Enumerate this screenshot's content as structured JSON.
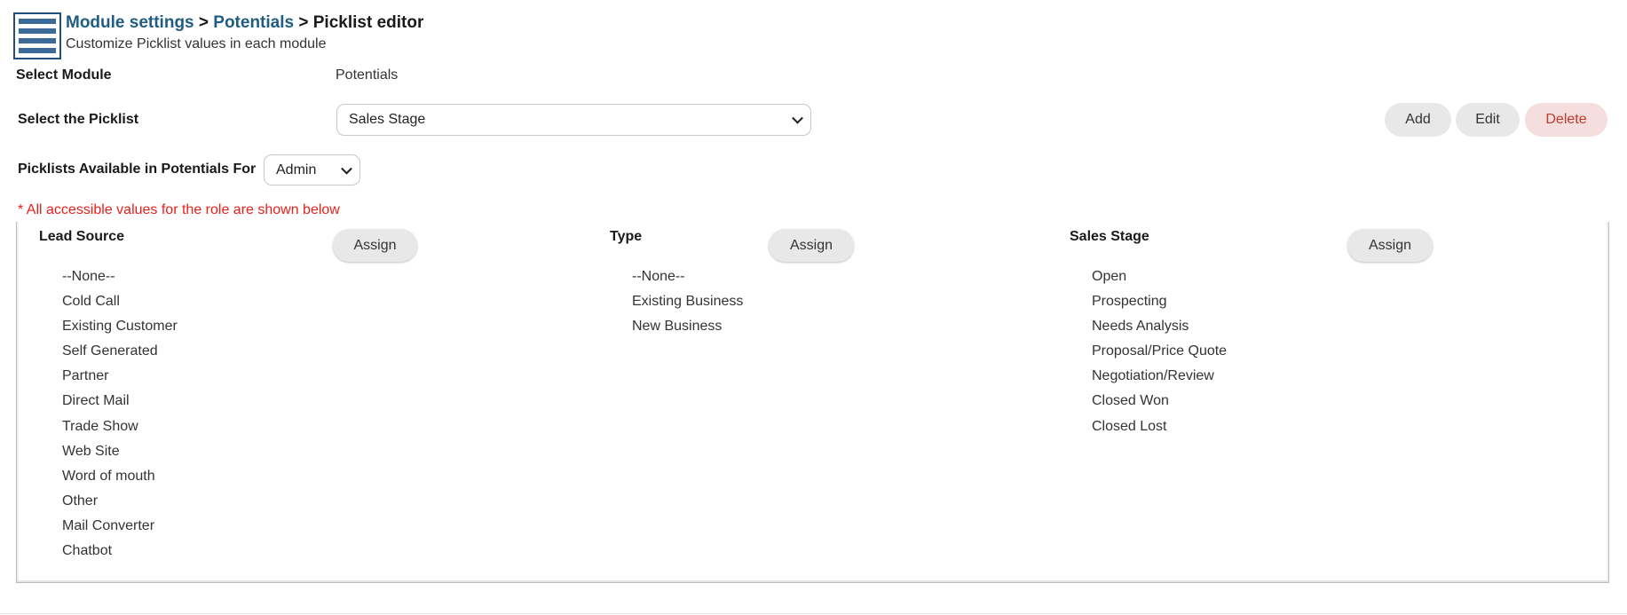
{
  "header": {
    "breadcrumb": [
      {
        "label": "Module settings",
        "link": true
      },
      {
        "label": "Potentials",
        "link": true
      },
      {
        "label": "Picklist editor",
        "link": false
      }
    ],
    "separator": " > ",
    "subtitle": "Customize Picklist values in each module",
    "icon": "list-icon"
  },
  "form": {
    "select_module_label": "Select Module",
    "select_module_value": "Potentials",
    "select_picklist_label": "Select the Picklist",
    "select_picklist_value": "Sales Stage",
    "available_for_label": "Picklists Available in Potentials For",
    "role_value": "Admin"
  },
  "actions": {
    "add": "Add",
    "edit": "Edit",
    "delete": "Delete"
  },
  "note": "* All accessible values for the role are shown below",
  "columns": [
    {
      "title": "Lead Source",
      "assign": "Assign",
      "values": [
        "--None--",
        "Cold Call",
        "Existing Customer",
        "Self Generated",
        "Partner",
        "Direct Mail",
        "Trade Show",
        "Web Site",
        "Word of mouth",
        "Other",
        "Mail Converter",
        "Chatbot"
      ]
    },
    {
      "title": "Type",
      "assign": "Assign",
      "values": [
        "--None--",
        "Existing Business",
        "New Business"
      ]
    },
    {
      "title": "Sales Stage",
      "assign": "Assign",
      "values": [
        "Open",
        "Prospecting",
        "Needs Analysis",
        "Proposal/Price Quote",
        "Negotiation/Review",
        "Closed Won",
        "Closed Lost"
      ]
    }
  ],
  "colors": {
    "link": "#1f5d82",
    "note": "#e8201a",
    "delete_bg": "#f7dede",
    "delete_text": "#c0392b",
    "button_bg": "#e8e8e8"
  }
}
